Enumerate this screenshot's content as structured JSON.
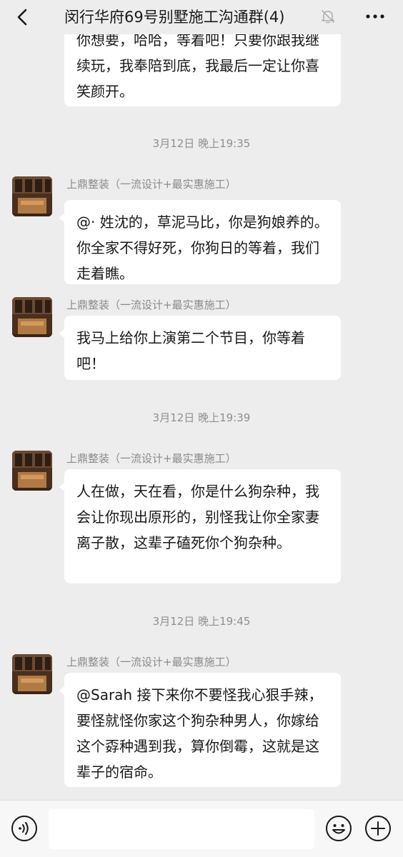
{
  "header": {
    "back_icon": "chevron-left-icon",
    "title": "闵行华府69号别墅施工沟通群(4)",
    "mute_icon": "bell-muted-icon",
    "more_icon": "more-dots-icon"
  },
  "messages": {
    "m0": {
      "text": "你想要，哈哈，等着吧！只要你跟我继续玩，我奉陪到底，我最后一定让你喜笑颜开。"
    },
    "t1": "3月12日 晚上19:35",
    "m1": {
      "sender": "上鼎整装（一流设计+最实惠施工）",
      "text": "@· 姓沈的，草泥马比，你是狗娘养的。你全家不得好死，你狗日的等着，我们走着瞧。"
    },
    "m2": {
      "sender": "上鼎整装（一流设计+最实惠施工）",
      "text": "我马上给你上演第二个节目，你等着吧！"
    },
    "t2": "3月12日 晚上19:39",
    "m3": {
      "sender": "上鼎整装（一流设计+最实惠施工）",
      "text": "人在做，天在看，你是什么狗杂种，我会让你现出原形的，别怪我让你全家妻离子散，这辈子磕死你个狗杂种。"
    },
    "t3": "3月12日 晚上19:45",
    "m4": {
      "sender": "上鼎整装（一流设计+最实惠施工）",
      "text": "@Sarah 接下来你不要怪我心狠手辣，要怪就怪你家这个狗杂种男人，你嫁给这个孬种遇到我，算你倒霉，这就是这辈子的宿命。"
    }
  },
  "input": {
    "voice_icon": "voice-icon",
    "emoji_icon": "emoji-icon",
    "plus_icon": "plus-icon",
    "value": ""
  },
  "colors": {
    "background": "#ededed",
    "bubble": "#ffffff",
    "time_text": "#8f8f8f",
    "sender_text": "#8a8a8a"
  }
}
